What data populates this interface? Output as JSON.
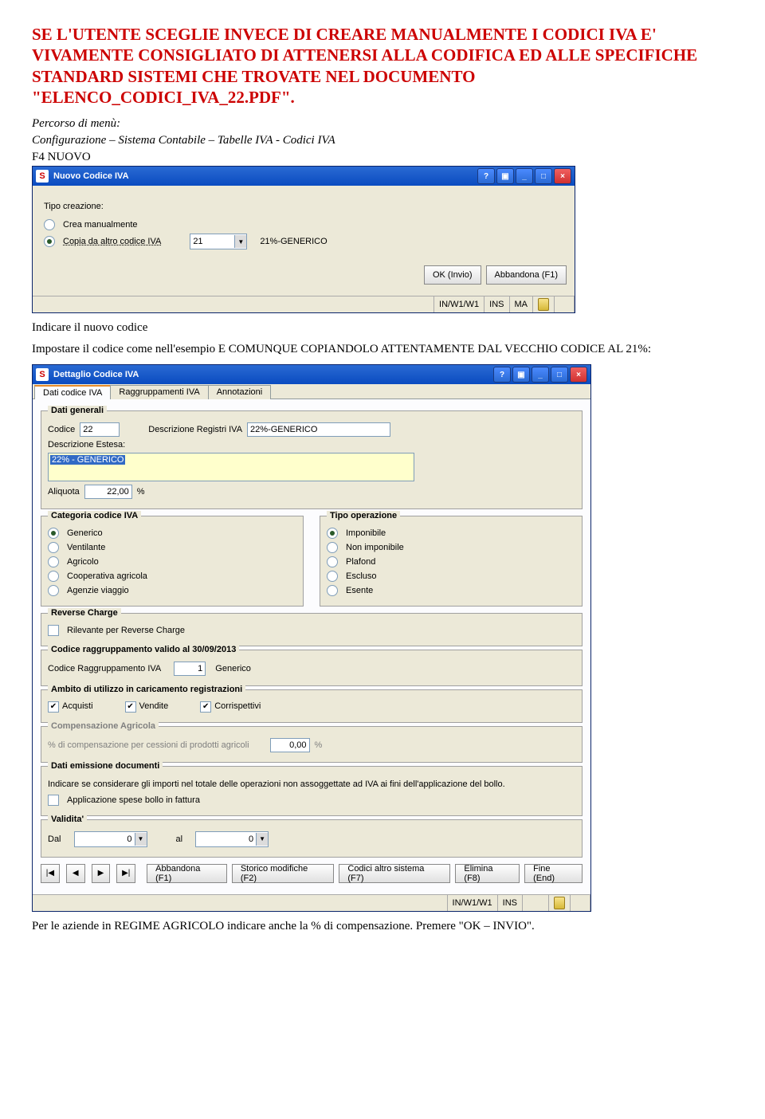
{
  "head": {
    "l1": "SE L'UTENTE SCEGLIE INVECE DI CREARE MANUALMENTE I CODICI IVA E' VIVAMENTE CONSIGLIATO DI ATTENERSI ALLA CODIFICA ED ALLE SPECIFICHE STANDARD SISTEMI CHE TROVATE NEL DOCUMENTO \"ELENCO_CODICI_IVA_22.PDF\"."
  },
  "menu": {
    "intro": "Percorso di menù:",
    "path": "Configurazione – Sistema Contabile – Tabelle IVA  -  Codici IVA",
    "f4": "F4 NUOVO"
  },
  "win1": {
    "title": "Nuovo Codice IVA",
    "group": "Tipo creazione:",
    "opt1": "Crea manualmente",
    "opt2": "Copia da altro codice IVA",
    "codeVal": "21",
    "codeDesc": "21%-GENERICO",
    "ok": "OK (Invio)",
    "abb": "Abbandona (F1)",
    "status": {
      "path": "IN/W1/W1",
      "ins": "INS",
      "ma": "MA"
    }
  },
  "mid": {
    "l1": "Indicare il nuovo codice",
    "l2": "Impostare il codice come nell'esempio E COMUNQUE COPIANDOLO ATTENTAMENTE DAL VECCHIO CODICE AL 21%:"
  },
  "win2": {
    "title": "Dettaglio Codice IVA",
    "tabs": [
      "Dati codice IVA",
      "Raggruppamenti IVA",
      "Annotazioni"
    ],
    "g_gen": "Dati generali",
    "codice_lbl": "Codice",
    "codice_val": "22",
    "descr_reg_lbl": "Descrizione Registri IVA",
    "descr_reg_val": "22%-GENERICO",
    "descr_est_lbl": "Descrizione Estesa:",
    "descr_est_val": "22% - GENERICO",
    "aliq_lbl": "Aliquota",
    "aliq_val": "22,00",
    "aliq_suf": "%",
    "g_cat": "Categoria codice IVA",
    "cat": [
      "Generico",
      "Ventilante",
      "Agricolo",
      "Cooperativa agricola",
      "Agenzie viaggio"
    ],
    "g_tipo": "Tipo operazione",
    "tipo": [
      "Imponibile",
      "Non imponibile",
      "Plafond",
      "Escluso",
      "Esente"
    ],
    "g_rev": "Reverse Charge",
    "rev_lbl": "Rilevante per Reverse Charge",
    "g_ragg": "Codice raggruppamento valido al 30/09/2013",
    "ragg_lbl": "Codice Raggruppamento IVA",
    "ragg_val": "1",
    "ragg_desc": "Generico",
    "g_amb": "Ambito di utilizzo in caricamento registrazioni",
    "amb": [
      "Acquisti",
      "Vendite",
      "Corrispettivi"
    ],
    "g_comp": "Compensazione Agricola",
    "comp_lbl": "% di compensazione per cessioni di prodotti agricoli",
    "comp_val": "0,00",
    "comp_suf": "%",
    "g_emis": "Dati emissione documenti",
    "emis_txt": "Indicare se considerare gli importi nel totale delle operazioni non assoggettate ad IVA ai fini dell'applicazione del bollo.",
    "emis_chk": "Applicazione spese bollo in fattura",
    "g_val": "Validita'",
    "val_dal": "Dal",
    "val_al": "al",
    "val_zero": "0",
    "btns": {
      "abb": "Abbandona (F1)",
      "stor": "Storico modifiche (F2)",
      "alt": "Codici altro sistema (F7)",
      "elim": "Elimina (F8)",
      "fine": "Fine (End)"
    },
    "status": {
      "path": "IN/W1/W1",
      "ins": "INS"
    }
  },
  "footer": "Per le aziende in REGIME AGRICOLO indicare anche la % di compensazione. Premere \"OK – INVIO\"."
}
